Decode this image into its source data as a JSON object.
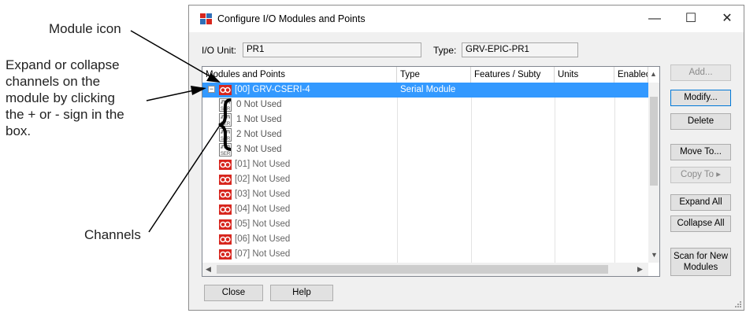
{
  "callouts": {
    "module_icon": "Module icon",
    "expand_collapse": [
      "Expand or collapse",
      "channels on the",
      "module by clicking",
      "the + or - sign in the",
      "box."
    ],
    "channels": "Channels"
  },
  "window": {
    "title": "Configure I/O Modules and Points",
    "minimize": "—",
    "maximize": "☐",
    "close": "✕",
    "io_unit_label": "I/O Unit:",
    "io_unit_value": "PR1",
    "type_label": "Type:",
    "type_value": "GRV-EPIC-PR1"
  },
  "grid": {
    "headers": [
      "Modules and Points",
      "Type",
      "Features / Subty",
      "Units",
      "Enablec"
    ],
    "rows": [
      {
        "label": "[00] GRV-CSERI-4",
        "type": "Serial Module"
      },
      {
        "label": "0  Not Used",
        "type": ""
      },
      {
        "label": "1  Not Used",
        "type": ""
      },
      {
        "label": "2  Not Used",
        "type": ""
      },
      {
        "label": "3  Not Used",
        "type": ""
      },
      {
        "label": "[01] Not Used",
        "type": ""
      },
      {
        "label": "[02] Not Used",
        "type": ""
      },
      {
        "label": "[03] Not Used",
        "type": ""
      },
      {
        "label": "[04] Not Used",
        "type": ""
      },
      {
        "label": "[05] Not Used",
        "type": ""
      },
      {
        "label": "[06] Not Used",
        "type": ""
      },
      {
        "label": "[07] Not Used",
        "type": ""
      }
    ],
    "expander_symbol": "−",
    "ser_label": "SER"
  },
  "buttons": {
    "add": "Add...",
    "modify": "Modify...",
    "delete": "Delete",
    "move_to": "Move To...",
    "copy_to": "Copy To  ▸",
    "expand_all": "Expand All",
    "collapse_all": "Collapse All",
    "scan_line1": "Scan for New",
    "scan_line2": "Modules",
    "close": "Close",
    "help": "Help"
  },
  "colors": {
    "selection": "#3399ff",
    "module_icon": "#d7261e",
    "arrow": "#000000"
  },
  "icons": {
    "module": "module-icon",
    "channel": "serial-channel-icon",
    "app": "app-icon"
  }
}
